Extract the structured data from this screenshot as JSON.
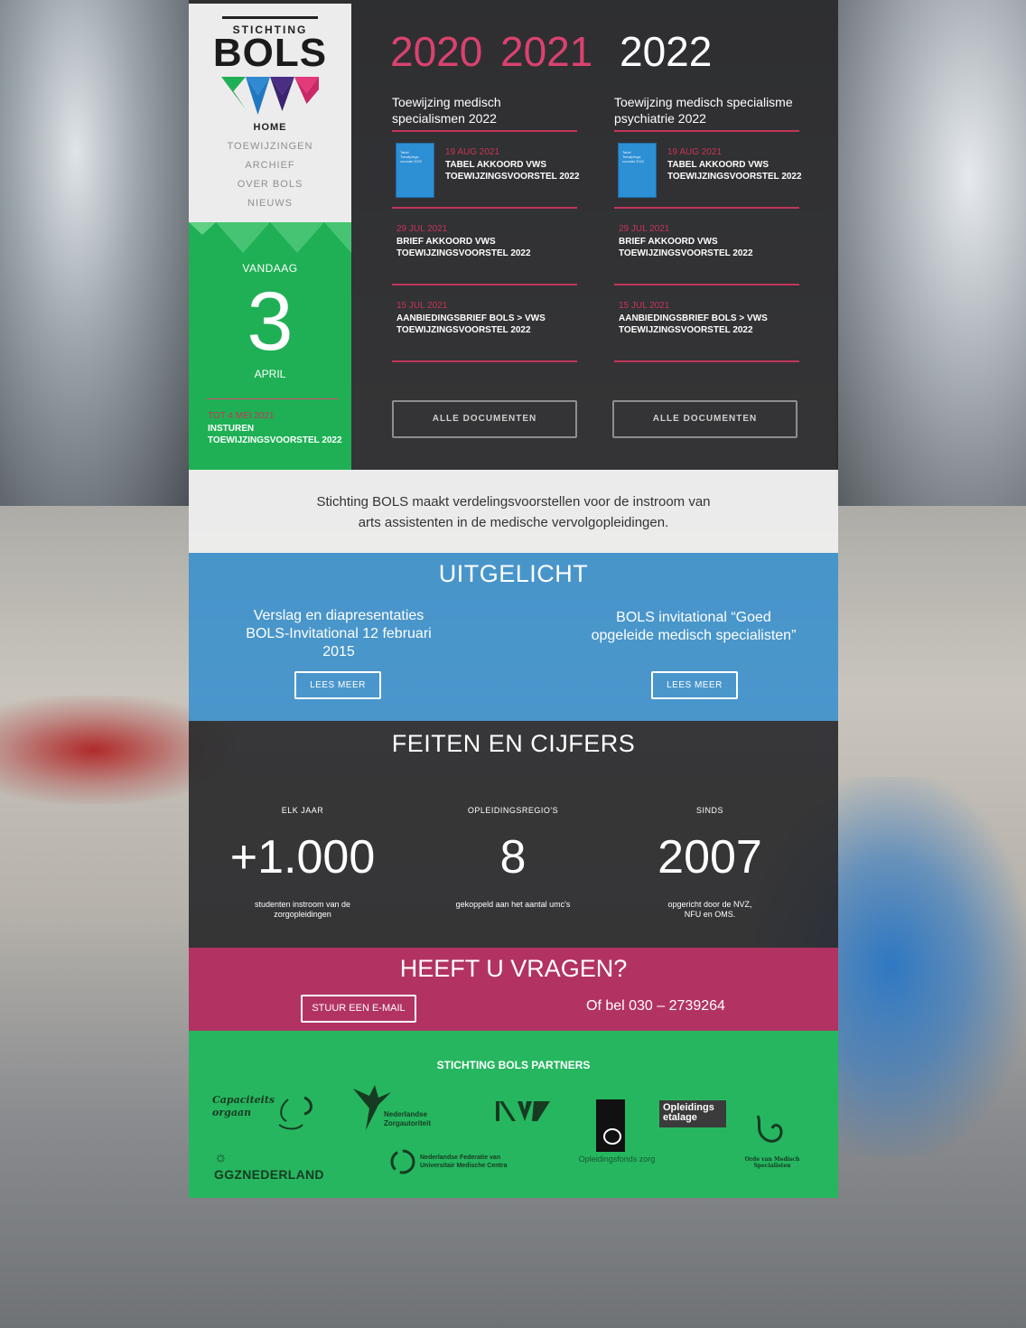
{
  "logo": {
    "line1": "STICHTING",
    "line2": "BOLS"
  },
  "nav": {
    "items": [
      {
        "label": "HOME"
      },
      {
        "label": "TOEWIJZINGEN"
      },
      {
        "label": "ARCHIEF"
      },
      {
        "label": "OVER BOLS"
      },
      {
        "label": "NIEUWS"
      }
    ]
  },
  "today": {
    "label": "VANDAAG",
    "day": "3",
    "month": "APRIL",
    "deadline_date": "TOT 4 MEI 2021",
    "deadline_text": "INSTUREN TOEWIJZINGSVOORSTEL 2022"
  },
  "years": [
    "2020",
    "2021",
    "2022"
  ],
  "columns": [
    {
      "title": "Toewijzing medisch specialismen 2022",
      "docs": [
        {
          "date": "19 AUG 2021",
          "text": "TABEL AKKOORD VWS TOEWIJZINGSVOORSTEL 2022",
          "thumb": "Tabel Toewijzings voorstel 2022"
        },
        {
          "date": "29 JUL 2021",
          "text": "BRIEF AKKOORD VWS TOEWIJZINGSVOORSTEL 2022"
        },
        {
          "date": "15 JUL 2021",
          "text": "AANBIEDINGSBRIEF BOLS > VWS TOEWIJZINGSVOORSTEL 2022"
        }
      ],
      "button": "ALLE DOCUMENTEN"
    },
    {
      "title": "Toewijzing medisch specialisme psychiatrie 2022",
      "docs": [
        {
          "date": "19 AUG 2021",
          "text": "TABEL AKKOORD VWS TOEWIJZINGSVOORSTEL 2022",
          "thumb": "Tabel Toewijzings voorstel 2022"
        },
        {
          "date": "29 JUL 2021",
          "text": "BRIEF AKKOORD VWS TOEWIJZINGSVOORSTEL 2022"
        },
        {
          "date": "15 JUL 2021",
          "text": "AANBIEDINGSBRIEF BOLS > VWS TOEWIJZINGSVOORSTEL 2022"
        }
      ],
      "button": "ALLE DOCUMENTEN"
    }
  ],
  "intro": "Stichting BOLS maakt verdelingsvoorstellen voor de instroom van arts assistenten in de medische vervolgopleidingen.",
  "featured": {
    "title": "UITGELICHT",
    "items": [
      {
        "text": "Verslag en diapresentaties BOLS-Invitational 12 februari 2015",
        "button": "LEES MEER"
      },
      {
        "text": "BOLS invitational “Goed opgeleide medisch specialisten”",
        "button": "LEES MEER"
      }
    ]
  },
  "facts": {
    "title": "FEITEN EN CIJFERS",
    "items": [
      {
        "label": "ELK JAAR",
        "value": "+1.000",
        "desc": "studenten instroom van de zorgopleidingen"
      },
      {
        "label": "OPLEIDINGSREGIO'S",
        "value": "8",
        "desc": "gekoppeld aan het aantal umc's"
      },
      {
        "label": "SINDS",
        "value": "2007",
        "desc": "opgericht door de NVZ, NFU en OMS."
      }
    ]
  },
  "contact": {
    "title": "HEEFT U VRAGEN?",
    "button": "STUUR EEN E-MAIL",
    "phone": "Of bel 030 – 2739264"
  },
  "partners": {
    "title": "STICHTING BOLS PARTNERS",
    "logos": {
      "capaciteitsorgaan": "Capaciteits orgaan",
      "nza": "Nederlandse Zorgautoriteit",
      "nvz": "NVZ",
      "opleidingsfonds": "Opleidingsfonds zorg",
      "etalage": "Opleidings etalage",
      "ggz": "GGZNEDERLAND",
      "nfu": "Nederlandse Federatie van Universitair Medische Centra",
      "oms": "Orde van Medisch Specialisten"
    }
  },
  "colors": {
    "pink": "#c3355b",
    "green": "#1fb055",
    "blue": "#3c91cd",
    "partners_green": "#26b65f"
  }
}
